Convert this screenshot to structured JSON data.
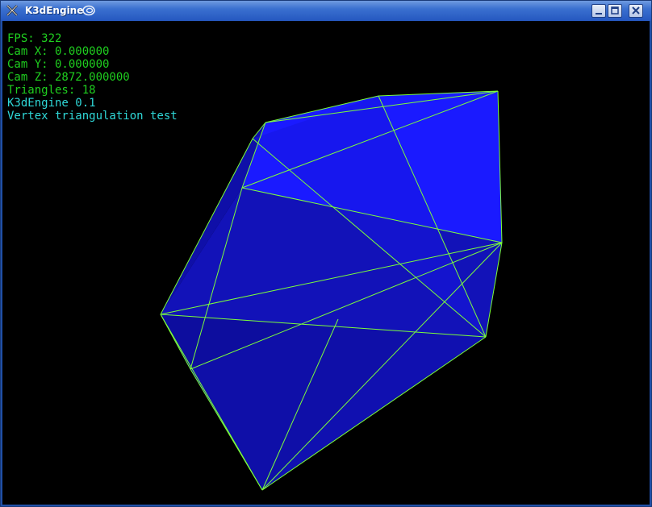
{
  "window": {
    "title": "K3dEngine",
    "icons": {
      "app": "x-icon",
      "swirl": "swirl-icon"
    },
    "buttons": [
      "minimize",
      "maximize",
      "close"
    ]
  },
  "hud": {
    "fps": "FPS: 322",
    "cam_x": "Cam X: 0.000000",
    "cam_y": "Cam Y: 0.000000",
    "cam_z": "Cam Z: 2872.000000",
    "triangles": "Triangles: 18",
    "engine": "K3dEngine 0.1",
    "test_name": "Vertex triangulation test"
  },
  "colors": {
    "viewport_bg": "#000000",
    "wire": "#7cff3a",
    "face_light": "#1a1aff",
    "face_dark": "#0d0d9e",
    "hud_green": "#1fcf1f",
    "hud_cyan": "#2fd8d8"
  }
}
